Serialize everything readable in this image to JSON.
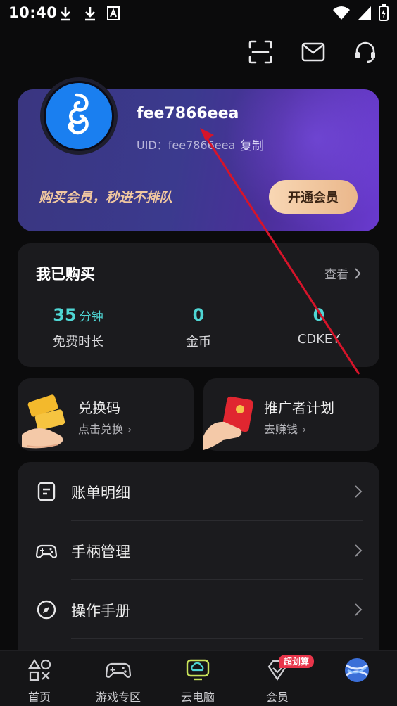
{
  "status_bar": {
    "time": "10:40"
  },
  "profile": {
    "username": "fee7866eea",
    "uid_text": "UID：fee7866eea",
    "copy_label": "复制",
    "promo_text": "购买会员，秒进不排队",
    "vip_button": "开通会员"
  },
  "purchased": {
    "title": "我已购买",
    "view_label": "查看",
    "stats": [
      {
        "value": "35",
        "unit": "分钟",
        "label": "免费时长"
      },
      {
        "value": "0",
        "unit": "",
        "label": "金币"
      },
      {
        "value": "0",
        "unit": "",
        "label": "CDKEY"
      }
    ]
  },
  "cards": {
    "redeem": {
      "title": "兑换码",
      "sub": "点击兑换"
    },
    "promoter": {
      "title": "推广者计划",
      "sub": "去赚钱"
    }
  },
  "menu": {
    "items": [
      {
        "label": "账单明细",
        "icon": "bill-icon"
      },
      {
        "label": "手柄管理",
        "icon": "gamepad-icon"
      },
      {
        "label": "操作手册",
        "icon": "compass-icon"
      }
    ]
  },
  "tabbar": {
    "badge": "超划算",
    "tabs": [
      {
        "label": "首页",
        "icon": "home-shapes-icon"
      },
      {
        "label": "游戏专区",
        "icon": "gamepad-icon"
      },
      {
        "label": "云电脑",
        "icon": "cloud-pc-icon"
      },
      {
        "label": "会员",
        "icon": "vip-diamond-icon"
      },
      {
        "label": "",
        "icon": "profile-avatar-icon"
      }
    ]
  },
  "colors": {
    "accent": "#4fd6d4",
    "vip_gold": "#eab78b",
    "card_bg": "#1b1b1e",
    "arrow": "#d6142a"
  }
}
